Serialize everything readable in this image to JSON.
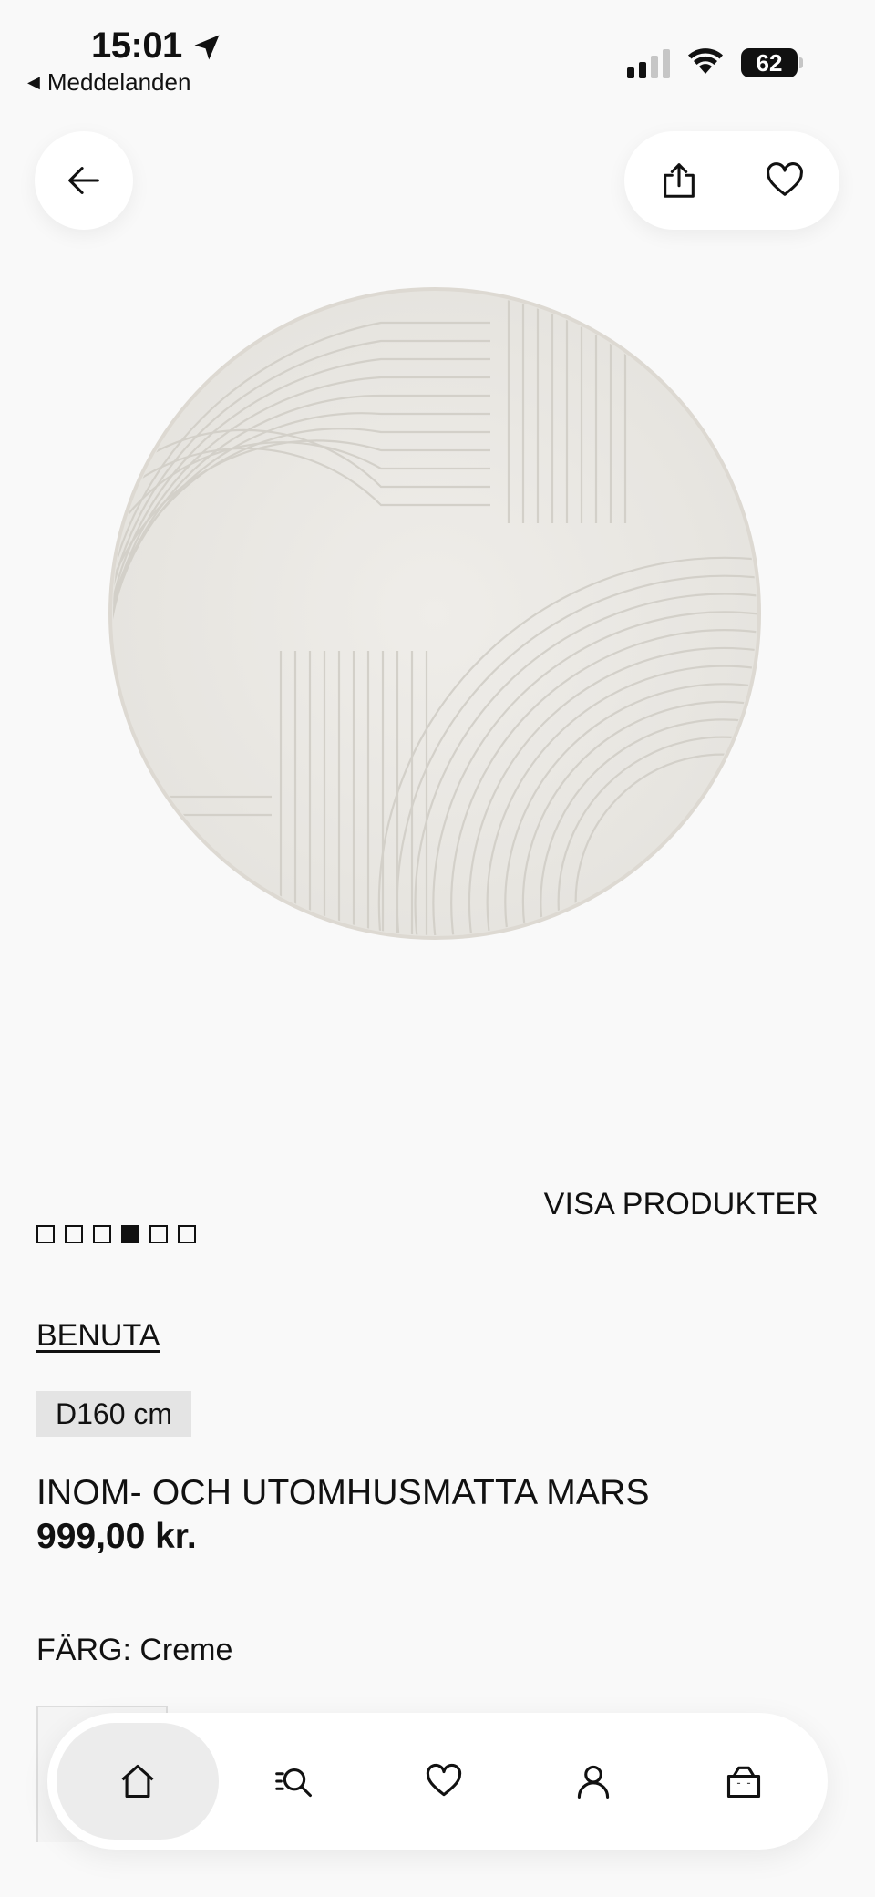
{
  "status_bar": {
    "time": "15:01",
    "back_app_label": "Meddelanden",
    "battery": "62",
    "signal_bars": 4,
    "signal_active_bars": 2
  },
  "top_actions": {
    "back_icon": "arrow-left-icon",
    "share_icon": "share-icon",
    "favorite_icon": "heart-icon"
  },
  "gallery": {
    "image": "round cream rug with wavy line pattern",
    "total_images": 6,
    "active_index": 4,
    "show_products_label": "VISA PRODUKTER"
  },
  "product": {
    "brand": "BENUTA",
    "size": "D160 cm",
    "title": "INOM- OCH UTOMHUSMATTA MARS",
    "price": "999,00 kr.",
    "color_label": "FÄRG: Creme"
  },
  "bottom_nav": {
    "items": [
      {
        "name": "home",
        "icon": "home-icon",
        "active": true
      },
      {
        "name": "search",
        "icon": "search-filter-icon",
        "active": false
      },
      {
        "name": "wishlist",
        "icon": "heart-icon",
        "active": false
      },
      {
        "name": "account",
        "icon": "person-icon",
        "active": false
      },
      {
        "name": "cart",
        "icon": "shopping-bag-icon",
        "active": false
      }
    ]
  },
  "colors": {
    "background": "#f9f9f9",
    "text": "#111111",
    "rug": "#ebe9e4",
    "badge": "#e4e4e4"
  }
}
